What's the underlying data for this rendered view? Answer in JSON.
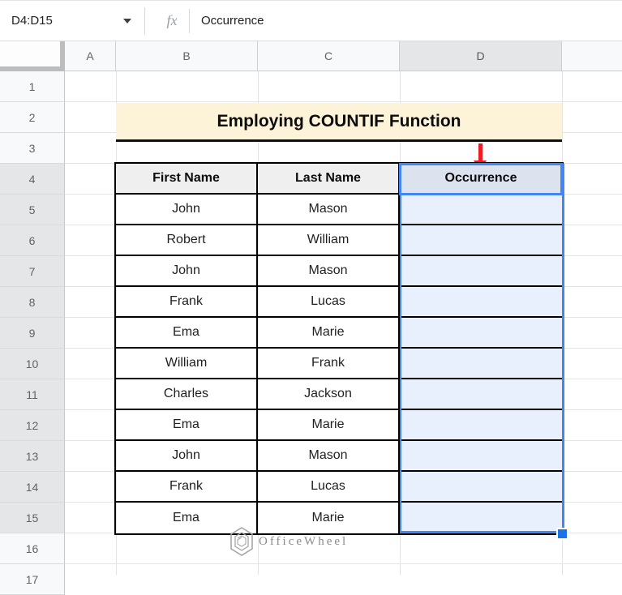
{
  "formula_bar": {
    "name_box_value": "D4:D15",
    "fx_label": "fx",
    "input_value": "Occurrence"
  },
  "sheet": {
    "column_headers": [
      "A",
      "B",
      "C",
      "D"
    ],
    "row_count": 17,
    "selected_column": "D",
    "selected_row_start": 4,
    "selected_row_end": 15
  },
  "banner": {
    "text": "Employing COUNTIF Function"
  },
  "table": {
    "headers": [
      "First Name",
      "Last Name",
      "Occurrence"
    ],
    "rows": [
      {
        "first": "John",
        "last": "Mason"
      },
      {
        "first": "Robert",
        "last": "William"
      },
      {
        "first": "John",
        "last": "Mason"
      },
      {
        "first": "Frank",
        "last": "Lucas"
      },
      {
        "first": "Ema",
        "last": "Marie"
      },
      {
        "first": "William",
        "last": "Frank"
      },
      {
        "first": "Charles",
        "last": "Jackson"
      },
      {
        "first": "Ema",
        "last": "Marie"
      },
      {
        "first": "John",
        "last": "Mason"
      },
      {
        "first": "Frank",
        "last": "Lucas"
      },
      {
        "first": "Ema",
        "last": "Marie"
      }
    ]
  },
  "watermark": {
    "text": "OfficeWheel"
  },
  "colors": {
    "selection_blue": "#4285f4",
    "selection_fill": "#e8f0fe",
    "active_header_fill": "#dce3ef",
    "banner_bg": "#fcf3d9",
    "table_header_bg": "#efefef",
    "arrow_red": "#ee1d24",
    "fill_handle_blue": "#1a73e8"
  }
}
